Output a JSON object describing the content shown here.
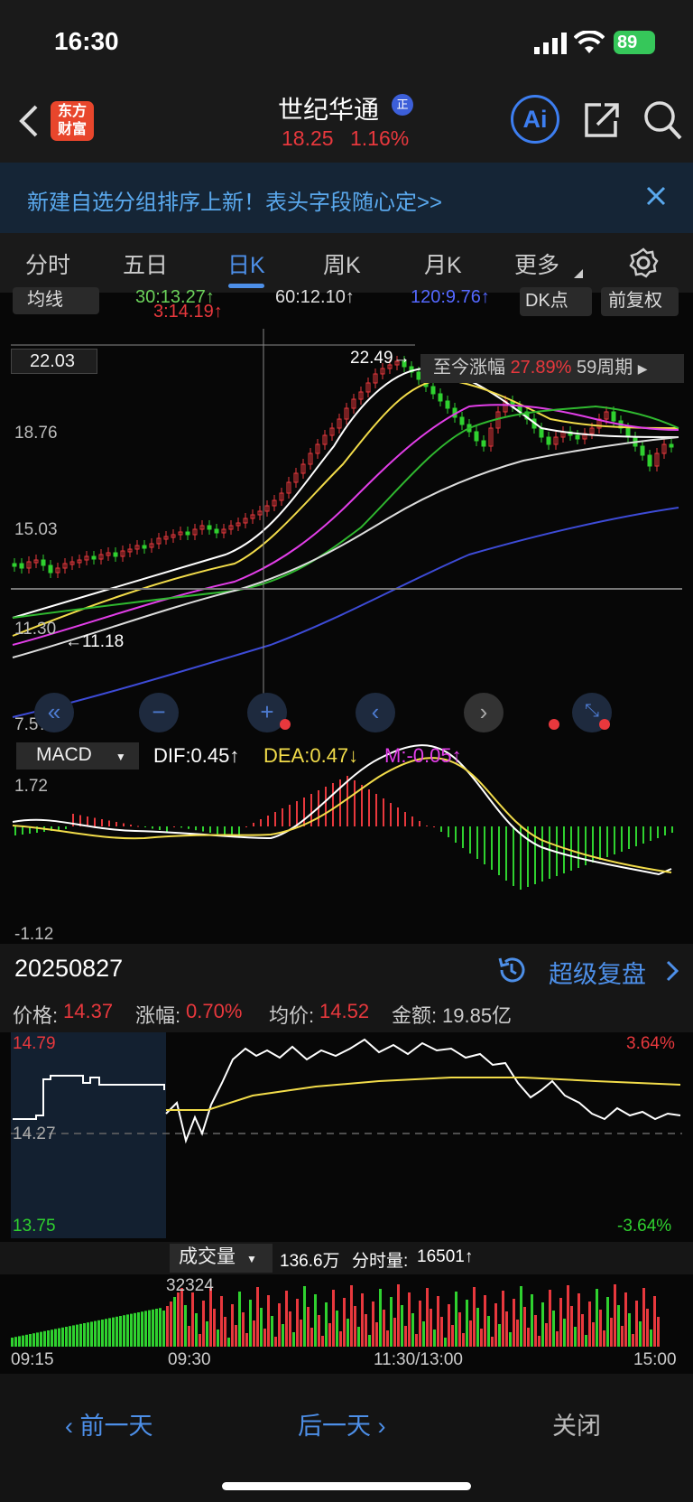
{
  "status": {
    "time": "16:30",
    "battery": "89"
  },
  "header": {
    "back_icon": "chevron-left-icon",
    "logo_text": "东方\n财富",
    "stock_name": "世纪华通",
    "badge": "正",
    "price": "18.25",
    "change": "1.16%",
    "ai_label": "Ai"
  },
  "banner": {
    "text": "新建自选分组排序上新！表头字段随心定>>"
  },
  "tabs": [
    {
      "label": "分时",
      "active": false
    },
    {
      "label": "五日",
      "active": false
    },
    {
      "label": "日K",
      "active": true
    },
    {
      "label": "周K",
      "active": false
    },
    {
      "label": "月K",
      "active": false
    },
    {
      "label": "更多",
      "active": false
    }
  ],
  "kline": {
    "ma_selector": "均线",
    "ma1": "30:13.27↑",
    "ma2": "60:12.10↑",
    "ma3": "120:9.76↑",
    "ma4": "3:14.19↑",
    "dk_label": "DK点",
    "fq_label": "前复权",
    "y_labels": [
      "22.03",
      "18.76",
      "15.03",
      "11.30",
      "7.57"
    ],
    "high_label": "22.49",
    "low_label": "11.18",
    "tip_label": "至今涨幅",
    "tip_value": "27.89%",
    "tip_period": "59周期",
    "crosshair_price": "22.03"
  },
  "macd": {
    "selector": "MACD",
    "dif": "DIF:0.45↑",
    "dea": "DEA:0.47↓",
    "m": "M:-0.05↑",
    "ytop": "1.72",
    "ybot": "-1.12"
  },
  "replay": {
    "date": "20250827",
    "label": "超级复盘"
  },
  "info": {
    "price_label": "价格:",
    "price": "14.37",
    "chg_label": "涨幅:",
    "chg": "0.70%",
    "avg_label": "均价:",
    "avg": "14.52",
    "amt_label": "金额:",
    "amt": "19.85亿"
  },
  "intraday": {
    "ytop": "14.79",
    "ymid": "14.27",
    "ybot": "13.75",
    "ptop": "3.64%",
    "pbot": "-3.64%"
  },
  "volume": {
    "selector": "成交量",
    "total": "136.6万",
    "per_label": "分时量:",
    "per": "16501↑",
    "peak": "32324",
    "times": [
      "09:15",
      "09:30",
      "11:30/13:00",
      "15:00"
    ]
  },
  "nav": {
    "prev": "前一天",
    "next": "后一天",
    "close": "关闭"
  },
  "colors": {
    "up": "#e8383d",
    "down": "#2fd12f",
    "accent": "#4d8fe8"
  }
}
